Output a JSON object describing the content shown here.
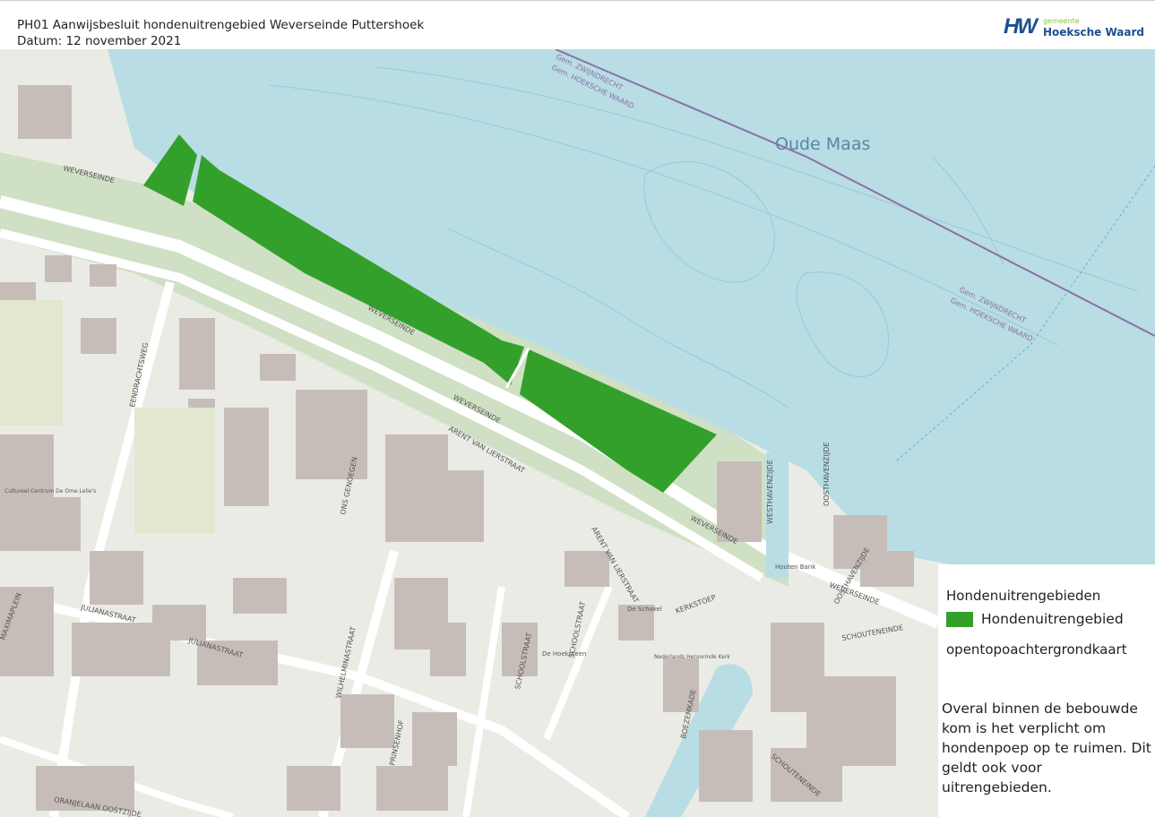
{
  "header": {
    "title_line1": "PH01 Aanwijsbesluit hondenuitrengebied Weverseinde Puttershoek",
    "title_line2": "Datum: 12 november 2021",
    "logo_mark": "HW",
    "logo_small": "gemeente",
    "logo_big": "Hoeksche Waard"
  },
  "map": {
    "river_label": "Oude Maas",
    "labels": {
      "weverseinde": "WEVERSEINDE",
      "arent": "ARENT VAN LIERSTRAAT",
      "julianastraat": "JULIANASTRAAT",
      "wilhelminastraat": "WILHELMINASTRAAT",
      "westhavenzijde": "WESTHAVENZIJDE",
      "oosthavenzijde": "OOSTHAVENZIJDE",
      "schoolstraat": "SCHOOLSTRAAT",
      "kerkstoep": "KERKSTOEP",
      "schouteneinde": "SCHOUTENEINDE",
      "eendrachtsweg": "EENDRACHTSWEG",
      "ons_genoegen": "ONS GENOEGEN",
      "prinsenhof": "PRINSENHOF",
      "boezemkade": "BOEZEMKADE",
      "oranjelaan": "ORANJELAAN OOSTZIJDE",
      "maximaplein": "MAXIMAPLEIN",
      "zwijndrecht": "Gem. ZWIJNDRECHT",
      "hoeksche": "Gem. HOEKSCHE WAARD",
      "houten_bank": "Houten Bank",
      "de_schakel": "De Schakel",
      "de_hoeksteen": "De Hoeksteen",
      "kerk": "Nederlands Hervormde Kerk",
      "cultureel": "Cultureel Centrum De Ome Lelie's"
    },
    "colors": {
      "water": "#b8dde4",
      "land": "#ebebe6",
      "dike": "#cfe0c4",
      "dog_area": "#34a02c",
      "building": "#c7bdb8",
      "road": "#ffffff"
    }
  },
  "legend": {
    "title": "Hondenuitrengebieden",
    "item": "Hondenuitrengebied",
    "basemap": "opentopoachtergrondkaart",
    "note": "Overal binnen de bebouwde kom is het verplicht om hondenpoep op te ruimen. Dit geldt ook voor uitrengebieden."
  }
}
